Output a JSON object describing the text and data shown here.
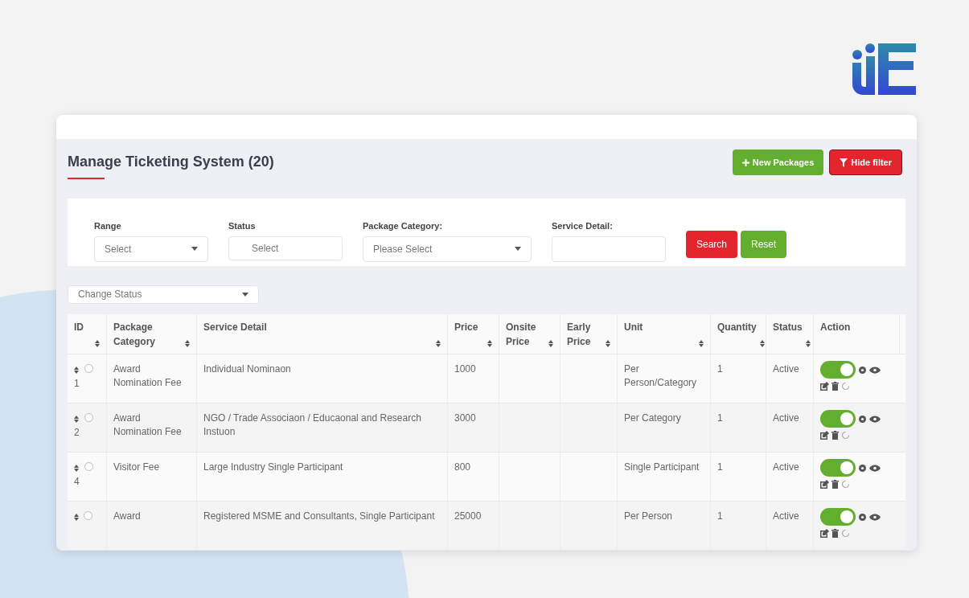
{
  "page": {
    "title": "Manage Ticketing System (20)"
  },
  "header_buttons": [
    {
      "label": "New Packages",
      "kind": "new"
    },
    {
      "label": "Hide filter",
      "kind": "filter"
    }
  ],
  "filters": [
    {
      "label": "Range",
      "kind": "select",
      "value": "Select"
    },
    {
      "label": "Status",
      "kind": "multiselect",
      "value": "Select"
    },
    {
      "label": "Package Category:",
      "kind": "select",
      "value": "Please Select"
    },
    {
      "label": "Service Detail:",
      "kind": "input"
    }
  ],
  "filter_buttons": [
    {
      "label": "Search",
      "kind": "danger"
    },
    {
      "label": "Reset",
      "kind": "success"
    }
  ],
  "bulk_action": {
    "value": "Change Status"
  },
  "table": {
    "columns": [
      "ID",
      "Package Category",
      "Service Detail",
      "Price",
      "Onsite Price",
      "Early Price",
      "Unit",
      "Quantity",
      "Status",
      "Action"
    ],
    "rows": [
      {
        "id": "1",
        "checked": false,
        "package_category": "Award Nomination Fee",
        "service_detail": "Individual Nominaon",
        "price": "1000",
        "unit": "Per Person/Category",
        "quantity": "1",
        "status": "Active",
        "on": true
      },
      {
        "id": "2",
        "checked": false,
        "package_category": "Award Nomination Fee",
        "service_detail": "NGO / Trade Associaon / Educaonal and Research Instuon",
        "price": "3000",
        "unit": "Per Category",
        "quantity": "1",
        "status": "Active",
        "on": true
      },
      {
        "id": "4",
        "checked": false,
        "package_category": "Visitor Fee",
        "service_detail": "Large Industry Single Participant",
        "price": "800",
        "unit": "Single Participant",
        "quantity": "1",
        "status": "Active",
        "on": true
      },
      {
        "checked": false,
        "package_category": "Award",
        "service_detail": "Registered MSME and Consultants, Single Participant",
        "price": "25000",
        "unit": "Per Person",
        "quantity": "1",
        "status": "Active",
        "on": true
      }
    ]
  }
}
